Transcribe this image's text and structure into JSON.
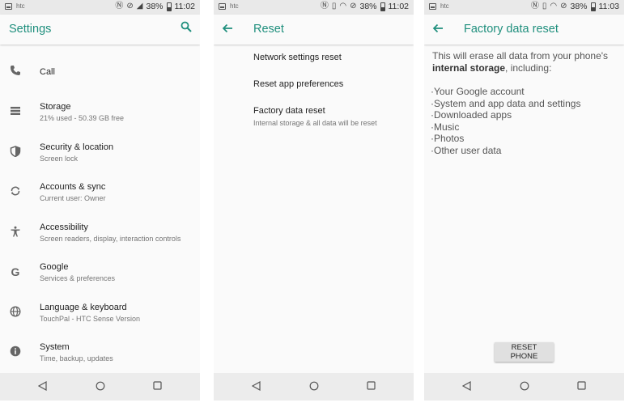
{
  "screen1": {
    "status": {
      "brand": "htc",
      "battery": "38%",
      "time": "11:02"
    },
    "title": "Settings",
    "items": [
      {
        "icon": "phone-icon",
        "title": "Call",
        "subtitle": ""
      },
      {
        "icon": "storage-icon",
        "title": "Storage",
        "subtitle": "21% used - 50.39 GB free"
      },
      {
        "icon": "shield-icon",
        "title": "Security & location",
        "subtitle": "Screen lock"
      },
      {
        "icon": "sync-icon",
        "title": "Accounts & sync",
        "subtitle": "Current user: Owner"
      },
      {
        "icon": "accessibility-icon",
        "title": "Accessibility",
        "subtitle": "Screen readers, display, interaction controls"
      },
      {
        "icon": "google-icon",
        "title": "Google",
        "subtitle": "Services & preferences"
      },
      {
        "icon": "globe-icon",
        "title": "Language & keyboard",
        "subtitle": "TouchPal - HTC Sense Version"
      },
      {
        "icon": "info-icon",
        "title": "System",
        "subtitle": "Time, backup, updates"
      }
    ]
  },
  "screen2": {
    "status": {
      "brand": "htc",
      "battery": "38%",
      "time": "11:02"
    },
    "title": "Reset",
    "items": [
      {
        "title": "Network settings reset",
        "subtitle": ""
      },
      {
        "title": "Reset app preferences",
        "subtitle": ""
      },
      {
        "title": "Factory data reset",
        "subtitle": "Internal storage & all data will be reset"
      }
    ]
  },
  "screen3": {
    "status": {
      "brand": "htc",
      "battery": "38%",
      "time": "11:03"
    },
    "title": "Factory data reset",
    "intro": "This will erase all data from your phone's",
    "intro_bold": "internal storage",
    "intro_end": ", including:",
    "list": [
      "·Your Google account",
      "·System and app data and settings",
      "·Downloaded apps",
      "·Music",
      "·Photos",
      "·Other user data"
    ],
    "button": "RESET PHONE"
  },
  "colors": {
    "accent": "#1f8f7d"
  }
}
